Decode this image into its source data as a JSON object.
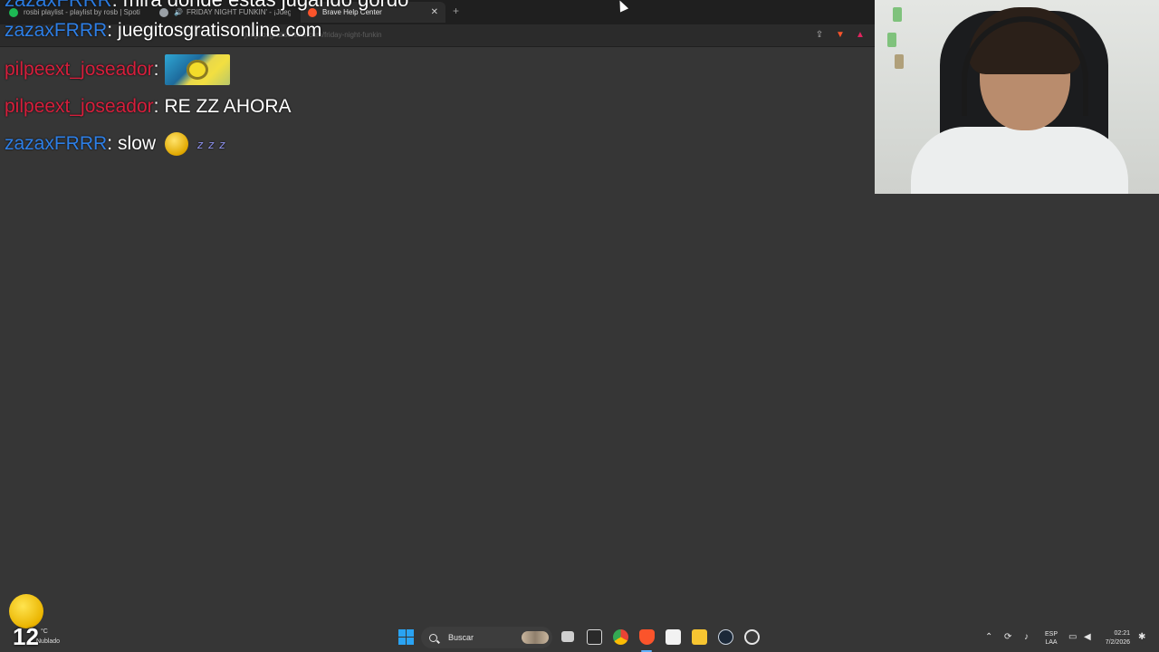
{
  "browser": {
    "tabs": [
      {
        "label": "rosbi playlist - playlist by rosb | Spoti",
        "favicon_color": "#1db954",
        "active": false
      },
      {
        "label": "FRIDAY NIGHT FUNKIN' - ¡Juega",
        "favicon_color": "#9aa0a6",
        "active": false,
        "audio": true
      },
      {
        "label": "Brave Help Center",
        "favicon_color": "#fb542b",
        "active": true
      }
    ],
    "close_glyph": "✕",
    "newtab_glyph": "+",
    "speaker_glyph": "🔊",
    "url_text": "juegitosgratisonline.com/friday-night-funkin",
    "toolbar_icons": [
      "share-icon",
      "brave-shields-icon",
      "brave-rewards-icon"
    ]
  },
  "chat": {
    "cut_message": {
      "user": "zazaxFRRR",
      "text": "mira donde estas jugando gordo"
    },
    "messages": [
      {
        "user": "zazaxFRRR",
        "color": "#2e7fe6",
        "text": "juegitosgratisonline.com",
        "emotes": []
      },
      {
        "user": "pilpeext_joseador",
        "color": "#d61f3c",
        "text": "",
        "emotes": [
          "minion-emote"
        ]
      },
      {
        "user": "pilpeext_joseador",
        "color": "#d61f3c",
        "text": "RE ZZ AHORA",
        "emotes": []
      },
      {
        "user": "zazaxFRRR",
        "color": "#2e7fe6",
        "text": "slow",
        "emotes": [
          "skull-emoji",
          "zzz-emote"
        ]
      }
    ],
    "separator": ":"
  },
  "weather_widget": {
    "temp_value": "12",
    "temp_unit": "°C",
    "condition": "Nublado"
  },
  "taskbar": {
    "search_placeholder": "Buscar",
    "apps": [
      "task-view-icon",
      "epic-games-icon",
      "chrome-icon",
      "brave-icon",
      "microsoft-store-icon",
      "file-explorer-icon",
      "steam-icon",
      "obs-icon"
    ],
    "language_line1": "ESP",
    "language_line2": "LAA",
    "time": "02:21",
    "date": "7/2/2026"
  }
}
